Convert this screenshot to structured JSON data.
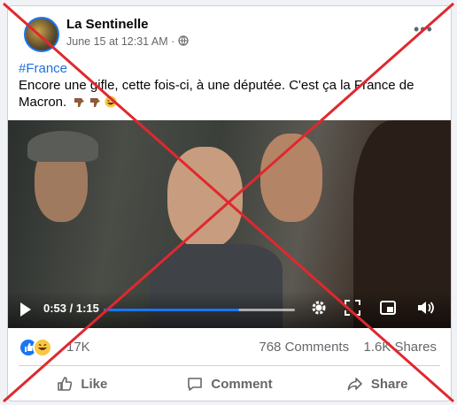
{
  "post": {
    "author": "La Sentinelle",
    "timestamp": "June 15 at 12:31 AM",
    "audience_icon": "globe-icon",
    "more_icon": "more-options-icon",
    "hashtag": "#France",
    "text": "Encore une gifle, cette fois-ci, à une députée. C'est ça la France de Macron.",
    "emojis": [
      "pointing-down-hand-icon",
      "pointing-down-hand-icon",
      "laughing-face-icon"
    ]
  },
  "video": {
    "time_display": "0:53 / 1:15",
    "progress": 0.71,
    "controls": [
      "play-icon",
      "settings-icon",
      "fullscreen-icon",
      "picture-in-picture-icon",
      "volume-icon"
    ]
  },
  "stats": {
    "reactions": [
      "like-icon",
      "haha-icon"
    ],
    "reaction_count": "17K",
    "comments": "768 Comments",
    "shares": "1.6K Shares"
  },
  "actions": {
    "like": "Like",
    "comment": "Comment",
    "share": "Share"
  },
  "overlay": {
    "mark": "red-x-mark",
    "color": "#e0282e"
  }
}
